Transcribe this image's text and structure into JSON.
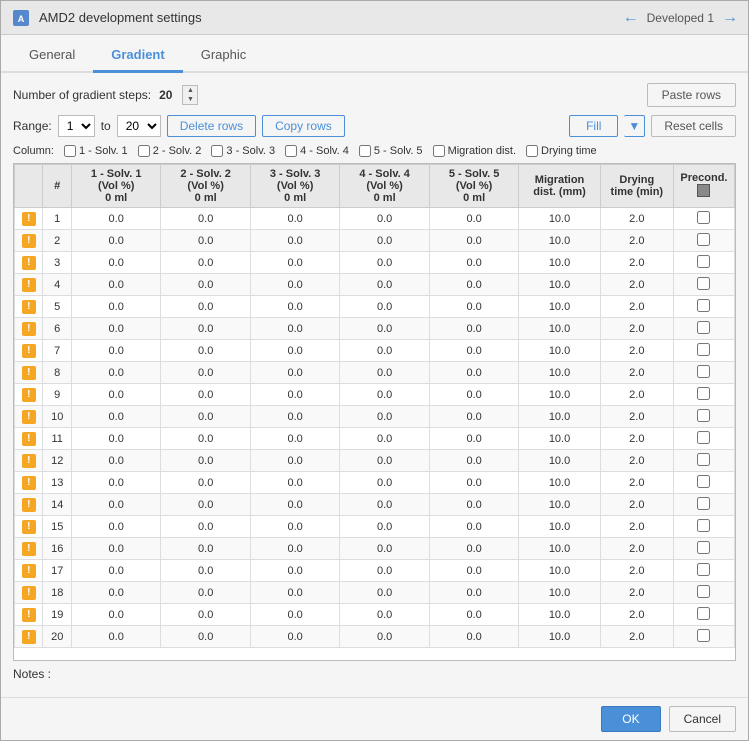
{
  "titleBar": {
    "icon": "amd2-icon",
    "title": "AMD2 development settings",
    "navLabel": "Developed 1"
  },
  "tabs": [
    {
      "id": "general",
      "label": "General",
      "active": false
    },
    {
      "id": "gradient",
      "label": "Gradient",
      "active": true
    },
    {
      "id": "graphic",
      "label": "Graphic",
      "active": false
    }
  ],
  "toolbar": {
    "stepsLabel": "Number of gradient steps:",
    "stepsValue": "20",
    "pasteRowsLabel": "Paste rows"
  },
  "range": {
    "label": "Range:",
    "from": "1",
    "to": "20",
    "deleteRowsLabel": "Delete rows",
    "copyRowsLabel": "Copy rows",
    "fillLabel": "Fill",
    "resetCellsLabel": "Reset cells"
  },
  "columns": {
    "label": "Column:",
    "items": [
      {
        "id": "solv1",
        "label": "1 - Solv. 1"
      },
      {
        "id": "solv2",
        "label": "2 - Solv. 2"
      },
      {
        "id": "solv3",
        "label": "3 - Solv. 3"
      },
      {
        "id": "solv4",
        "label": "4 - Solv. 4"
      },
      {
        "id": "solv5",
        "label": "5 - Solv. 5"
      },
      {
        "id": "migration",
        "label": "Migration dist."
      },
      {
        "id": "drying",
        "label": "Drying time"
      }
    ]
  },
  "tableHeaders": {
    "hash": "#",
    "num": "#",
    "solv1": "1 - Solv. 1\n(Vol %)\n0 ml",
    "solv2": "2 - Solv. 2\n(Vol %)\n0 ml",
    "solv3": "3 - Solv. 3\n(Vol %)\n0 ml",
    "solv4": "4 - Solv. 4\n(Vol %)\n0 ml",
    "solv5": "5 - Solv. 5\n(Vol %)\n0 ml",
    "migration": "Migration\ndist. (mm)",
    "drying": "Drying\ntime (min)",
    "precond": "Precond."
  },
  "tableRows": [
    {
      "num": 1,
      "s1": "0.0",
      "s2": "0.0",
      "s3": "0.0",
      "s4": "0.0",
      "s5": "0.0",
      "mig": "10.0",
      "dry": "2.0",
      "pre": false
    },
    {
      "num": 2,
      "s1": "0.0",
      "s2": "0.0",
      "s3": "0.0",
      "s4": "0.0",
      "s5": "0.0",
      "mig": "10.0",
      "dry": "2.0",
      "pre": false
    },
    {
      "num": 3,
      "s1": "0.0",
      "s2": "0.0",
      "s3": "0.0",
      "s4": "0.0",
      "s5": "0.0",
      "mig": "10.0",
      "dry": "2.0",
      "pre": false
    },
    {
      "num": 4,
      "s1": "0.0",
      "s2": "0.0",
      "s3": "0.0",
      "s4": "0.0",
      "s5": "0.0",
      "mig": "10.0",
      "dry": "2.0",
      "pre": false
    },
    {
      "num": 5,
      "s1": "0.0",
      "s2": "0.0",
      "s3": "0.0",
      "s4": "0.0",
      "s5": "0.0",
      "mig": "10.0",
      "dry": "2.0",
      "pre": false
    },
    {
      "num": 6,
      "s1": "0.0",
      "s2": "0.0",
      "s3": "0.0",
      "s4": "0.0",
      "s5": "0.0",
      "mig": "10.0",
      "dry": "2.0",
      "pre": false
    },
    {
      "num": 7,
      "s1": "0.0",
      "s2": "0.0",
      "s3": "0.0",
      "s4": "0.0",
      "s5": "0.0",
      "mig": "10.0",
      "dry": "2.0",
      "pre": false
    },
    {
      "num": 8,
      "s1": "0.0",
      "s2": "0.0",
      "s3": "0.0",
      "s4": "0.0",
      "s5": "0.0",
      "mig": "10.0",
      "dry": "2.0",
      "pre": false
    },
    {
      "num": 9,
      "s1": "0.0",
      "s2": "0.0",
      "s3": "0.0",
      "s4": "0.0",
      "s5": "0.0",
      "mig": "10.0",
      "dry": "2.0",
      "pre": false
    },
    {
      "num": 10,
      "s1": "0.0",
      "s2": "0.0",
      "s3": "0.0",
      "s4": "0.0",
      "s5": "0.0",
      "mig": "10.0",
      "dry": "2.0",
      "pre": false
    },
    {
      "num": 11,
      "s1": "0.0",
      "s2": "0.0",
      "s3": "0.0",
      "s4": "0.0",
      "s5": "0.0",
      "mig": "10.0",
      "dry": "2.0",
      "pre": false
    },
    {
      "num": 12,
      "s1": "0.0",
      "s2": "0.0",
      "s3": "0.0",
      "s4": "0.0",
      "s5": "0.0",
      "mig": "10.0",
      "dry": "2.0",
      "pre": false
    },
    {
      "num": 13,
      "s1": "0.0",
      "s2": "0.0",
      "s3": "0.0",
      "s4": "0.0",
      "s5": "0.0",
      "mig": "10.0",
      "dry": "2.0",
      "pre": false
    },
    {
      "num": 14,
      "s1": "0.0",
      "s2": "0.0",
      "s3": "0.0",
      "s4": "0.0",
      "s5": "0.0",
      "mig": "10.0",
      "dry": "2.0",
      "pre": false
    },
    {
      "num": 15,
      "s1": "0.0",
      "s2": "0.0",
      "s3": "0.0",
      "s4": "0.0",
      "s5": "0.0",
      "mig": "10.0",
      "dry": "2.0",
      "pre": false
    },
    {
      "num": 16,
      "s1": "0.0",
      "s2": "0.0",
      "s3": "0.0",
      "s4": "0.0",
      "s5": "0.0",
      "mig": "10.0",
      "dry": "2.0",
      "pre": false
    },
    {
      "num": 17,
      "s1": "0.0",
      "s2": "0.0",
      "s3": "0.0",
      "s4": "0.0",
      "s5": "0.0",
      "mig": "10.0",
      "dry": "2.0",
      "pre": false
    },
    {
      "num": 18,
      "s1": "0.0",
      "s2": "0.0",
      "s3": "0.0",
      "s4": "0.0",
      "s5": "0.0",
      "mig": "10.0",
      "dry": "2.0",
      "pre": false
    },
    {
      "num": 19,
      "s1": "0.0",
      "s2": "0.0",
      "s3": "0.0",
      "s4": "0.0",
      "s5": "0.0",
      "mig": "10.0",
      "dry": "2.0",
      "pre": false
    },
    {
      "num": 20,
      "s1": "0.0",
      "s2": "0.0",
      "s3": "0.0",
      "s4": "0.0",
      "s5": "0.0",
      "mig": "10.0",
      "dry": "2.0",
      "pre": false
    }
  ],
  "notes": {
    "label": "Notes :"
  },
  "footer": {
    "okLabel": "OK",
    "cancelLabel": "Cancel"
  }
}
